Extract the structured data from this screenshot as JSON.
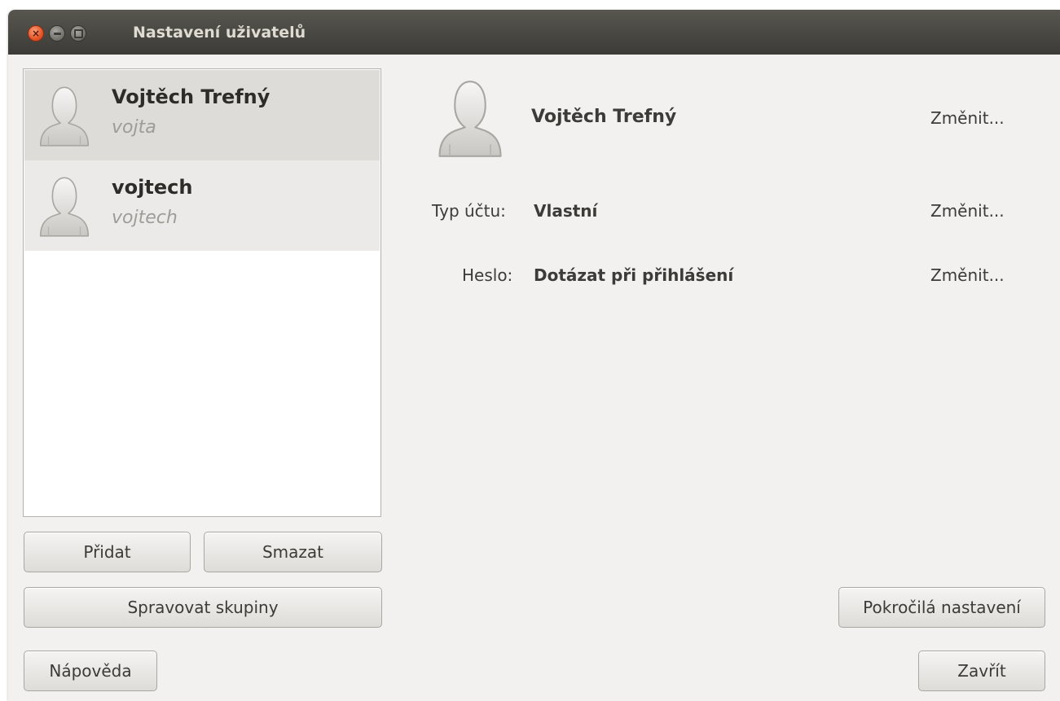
{
  "window": {
    "title": "Nastavení uživatelů"
  },
  "user_list": {
    "users": [
      {
        "name": "Vojtěch Trefný",
        "login": "vojta",
        "selected": true
      },
      {
        "name": "vojtech",
        "login": "vojtech",
        "selected": false
      }
    ]
  },
  "list_buttons": {
    "add": "Přidat",
    "delete": "Smazat",
    "manage_groups": "Spravovat skupiny"
  },
  "details": {
    "name": "Vojtěch Trefný",
    "name_change": "Změnit...",
    "account_type_label": "Typ účtu:",
    "account_type_value": "Vlastní",
    "account_type_change": "Změnit...",
    "password_label": "Heslo:",
    "password_value": "Dotázat při přihlášení",
    "password_change": "Změnit..."
  },
  "footer": {
    "advanced": "Pokročilá nastavení",
    "help": "Nápověda",
    "close": "Zavřít"
  },
  "icons": {
    "close": "close-icon",
    "minimize": "minimize-icon",
    "maximize": "maximize-icon",
    "avatar": "user-avatar-icon"
  },
  "colors": {
    "titlebar": "#3c3b37",
    "window_bg": "#f2f1f0",
    "close_button": "#e55427",
    "selected_row": "#dedcd8"
  }
}
